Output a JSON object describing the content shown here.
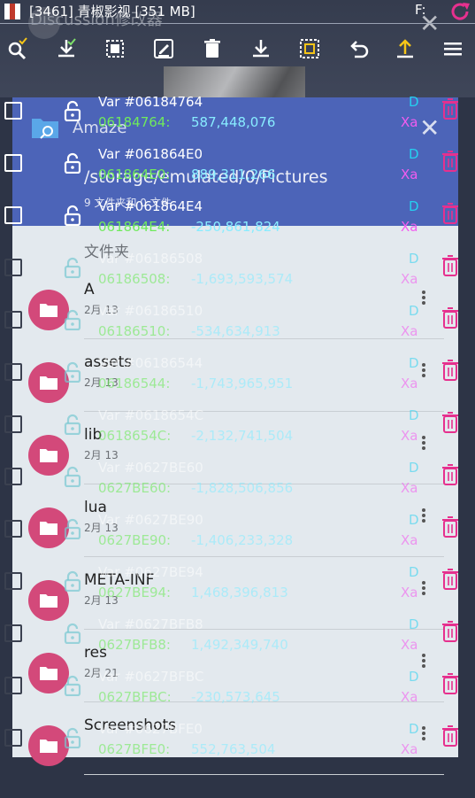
{
  "status": {
    "app_title": "[3461] 青椒影视 [351 MB]",
    "indicator": "F:",
    "flag_colors": [
      "#ffffff",
      "#c0392b",
      "#ffffff"
    ]
  },
  "toolbar": {
    "icons": [
      "search-icon",
      "select-all-icon",
      "select-range-icon",
      "edit-icon",
      "delete-icon",
      "save-icon",
      "invert-selection-icon",
      "undo-icon",
      "load-icon",
      "menu-icon"
    ]
  },
  "background_app": {
    "chat_title": "Discussion修改器",
    "app_name": "Amaze",
    "path": "/storage/emulated/0/Pictures",
    "count": "9 文件夹和 0 文件",
    "section": "文件夹",
    "folders": [
      {
        "name": "A",
        "date": "2月 13"
      },
      {
        "name": "assets",
        "date": "2月 13"
      },
      {
        "name": "lib",
        "date": "2月 13"
      },
      {
        "name": "lua",
        "date": "2月 13"
      },
      {
        "name": "META-INF",
        "date": "2月 13"
      },
      {
        "name": "res",
        "date": "2月 21"
      },
      {
        "name": "Screenshots",
        "date": ""
      }
    ],
    "accent_color": "#4c64b8",
    "folder_color": "#d3497a"
  },
  "values": [
    {
      "name": "Var #06184764",
      "addr": "06184764:",
      "value": "587,448,076",
      "type": "D",
      "type2": "Xa",
      "dim": false
    },
    {
      "name": "Var #061864E0",
      "addr": "061864E0:",
      "value": "889,311,266",
      "type": "D",
      "type2": "Xa",
      "dim": false
    },
    {
      "name": "Var #061864E4",
      "addr": "061864E4:",
      "value": "-250,861,824",
      "type": "D",
      "type2": "Xa",
      "dim": false
    },
    {
      "name": "Var #06186508",
      "addr": "06186508:",
      "value": "-1,693,593,574",
      "type": "D",
      "type2": "Xa",
      "dim": true
    },
    {
      "name": "Var #06186510",
      "addr": "06186510:",
      "value": "-534,634,913",
      "type": "D",
      "type2": "Xa",
      "dim": true
    },
    {
      "name": "Var #06186544",
      "addr": "06186544:",
      "value": "-1,743,965,951",
      "type": "D",
      "type2": "Xa",
      "dim": true
    },
    {
      "name": "Var #0618654C",
      "addr": "0618654C:",
      "value": "-2,132,741,504",
      "type": "D",
      "type2": "Xa",
      "dim": true
    },
    {
      "name": "Var #0627BE60",
      "addr": "0627BE60:",
      "value": "-1,828,506,856",
      "type": "D",
      "type2": "Xa",
      "dim": true
    },
    {
      "name": "Var #0627BE90",
      "addr": "0627BE90:",
      "value": "-1,406,233,328",
      "type": "D",
      "type2": "Xa",
      "dim": true
    },
    {
      "name": "Var #0627BE94",
      "addr": "0627BE94:",
      "value": "1,468,396,813",
      "type": "D",
      "type2": "Xa",
      "dim": true
    },
    {
      "name": "Var #0627BFB8",
      "addr": "0627BFB8:",
      "value": "1,492,349,740",
      "type": "D",
      "type2": "Xa",
      "dim": true
    },
    {
      "name": "Var #0627BFBC",
      "addr": "0627BFBC:",
      "value": "-230,573,645",
      "type": "D",
      "type2": "Xa",
      "dim": true
    },
    {
      "name": "Var #0627BFE0",
      "addr": "0627BFE0:",
      "value": "552,763,504",
      "type": "D",
      "type2": "Xa",
      "dim": true
    }
  ],
  "colors": {
    "address": "#6fea5c",
    "value": "#88ecff",
    "type_d": "#25d0f0",
    "type_xa": "#f25cf0",
    "delete": "#e6308e"
  }
}
